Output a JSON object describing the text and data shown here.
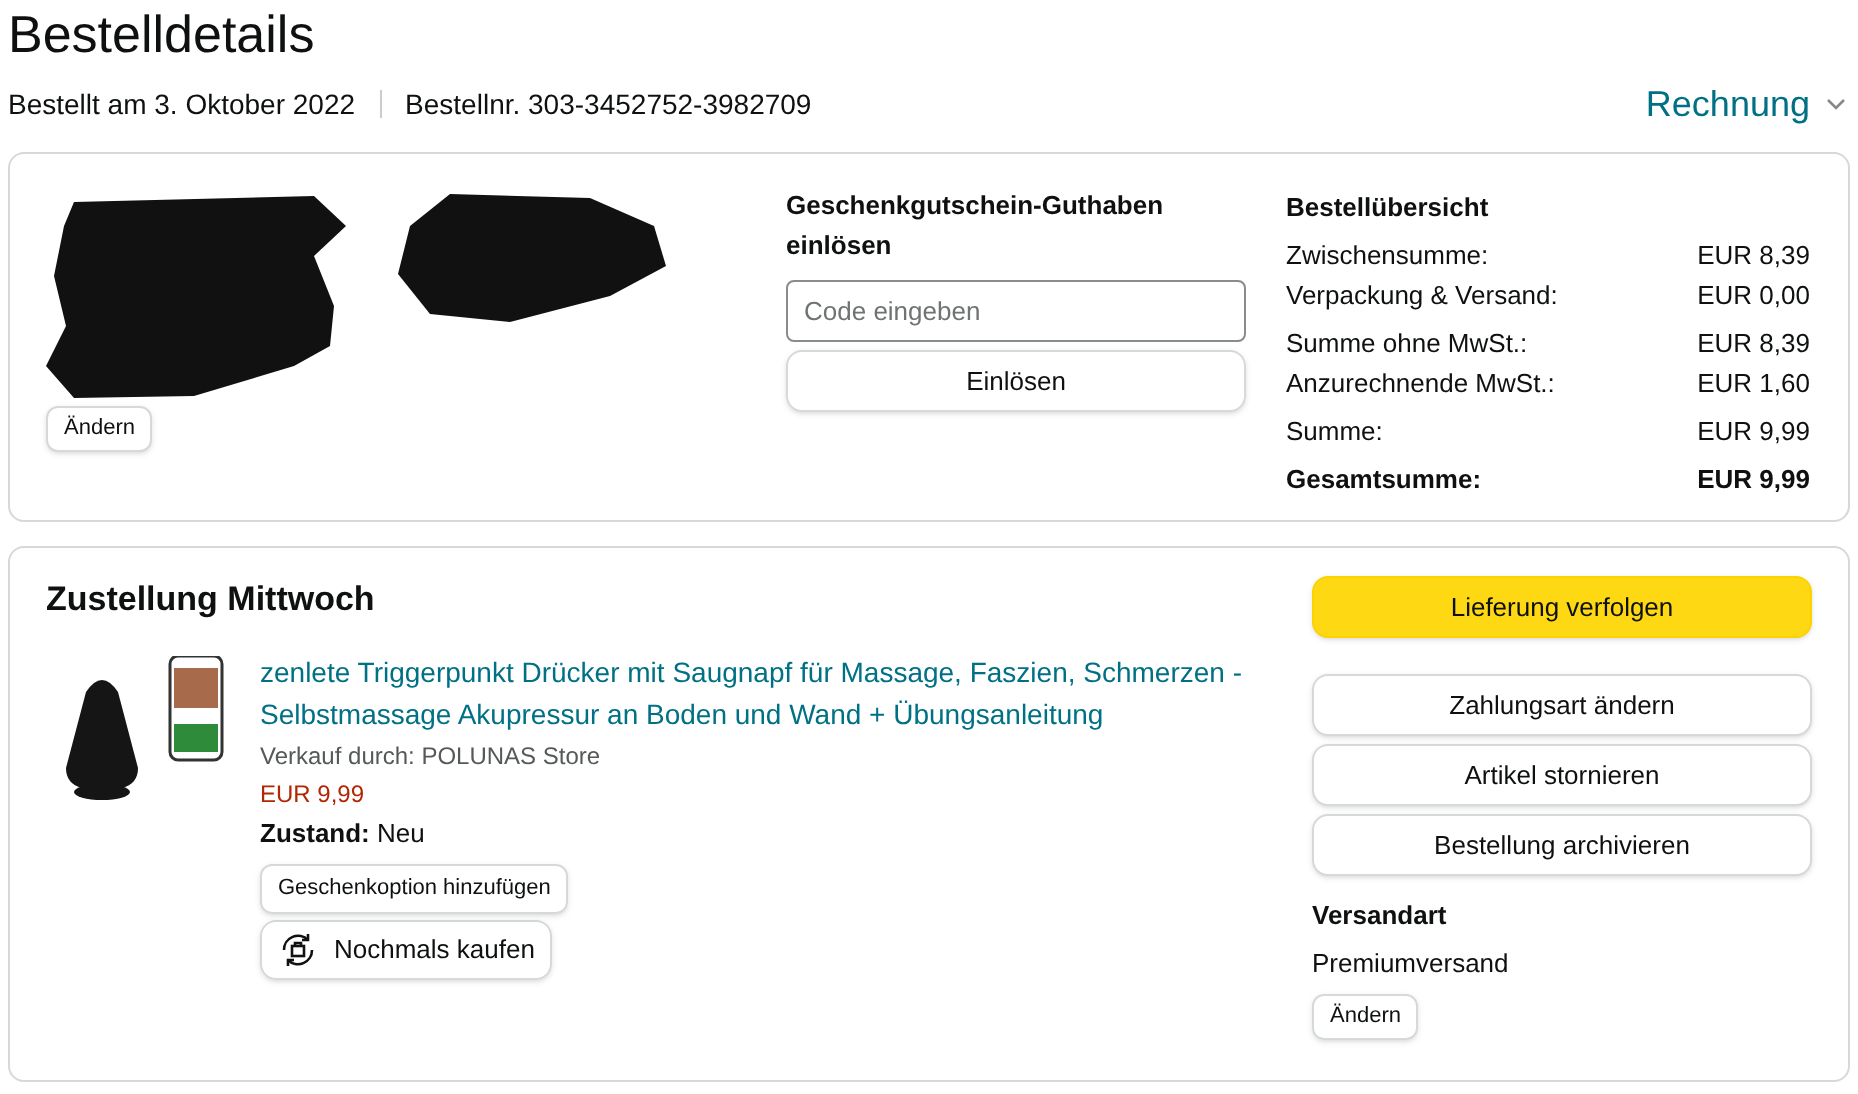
{
  "title": "Bestelldetails",
  "meta": {
    "ordered": "Bestellt am 3. Oktober 2022",
    "order_number": "Bestellnr. 303-3452752-3982709",
    "invoice": "Rechnung"
  },
  "address": {
    "change": "Ändern"
  },
  "gift": {
    "title": "Geschenkgutschein-Guthaben einlösen",
    "placeholder": "Code eingeben",
    "button": "Einlösen"
  },
  "summary": {
    "title": "Bestellübersicht",
    "groups": [
      [
        {
          "label": "Zwischensumme:",
          "value": "EUR 8,39",
          "total": false
        },
        {
          "label": "Verpackung & Versand:",
          "value": "EUR 0,00",
          "total": false
        }
      ],
      [
        {
          "label": "Summe ohne MwSt.:",
          "value": "EUR 8,39",
          "total": false
        },
        {
          "label": "Anzurechnende MwSt.:",
          "value": "EUR 1,60",
          "total": false
        }
      ],
      [
        {
          "label": "Summe:",
          "value": "EUR 9,99",
          "total": false
        }
      ],
      [
        {
          "label": "Gesamtsumme:",
          "value": "EUR 9,99",
          "total": true
        }
      ]
    ]
  },
  "delivery": {
    "title": "Zustellung Mittwoch",
    "product": {
      "name": "zenlete Triggerpunkt Drücker mit Saugnapf für Massage, Faszien, Schmerzen - Selbstmassage Akupressur an Boden und Wand + Übungsanleitung",
      "seller": "Verkauf durch: POLUNAS Store",
      "price": "EUR 9,99",
      "condition": "**Zustand:** Neu",
      "gift_button": "Geschenkoption hinzufügen",
      "buy_again": "Nochmals kaufen"
    },
    "actions": [
      {
        "label": "Lieferung verfolgen",
        "kind": "primary"
      },
      {
        "label": "Zahlungsart ändern",
        "kind": "secondary"
      },
      {
        "label": "Artikel stornieren",
        "kind": "secondary"
      },
      {
        "label": "Bestellung archivieren",
        "kind": "secondary"
      }
    ],
    "shipping": {
      "title": "Versandart",
      "value": "Premiumversand",
      "change": "Ändern"
    }
  }
}
